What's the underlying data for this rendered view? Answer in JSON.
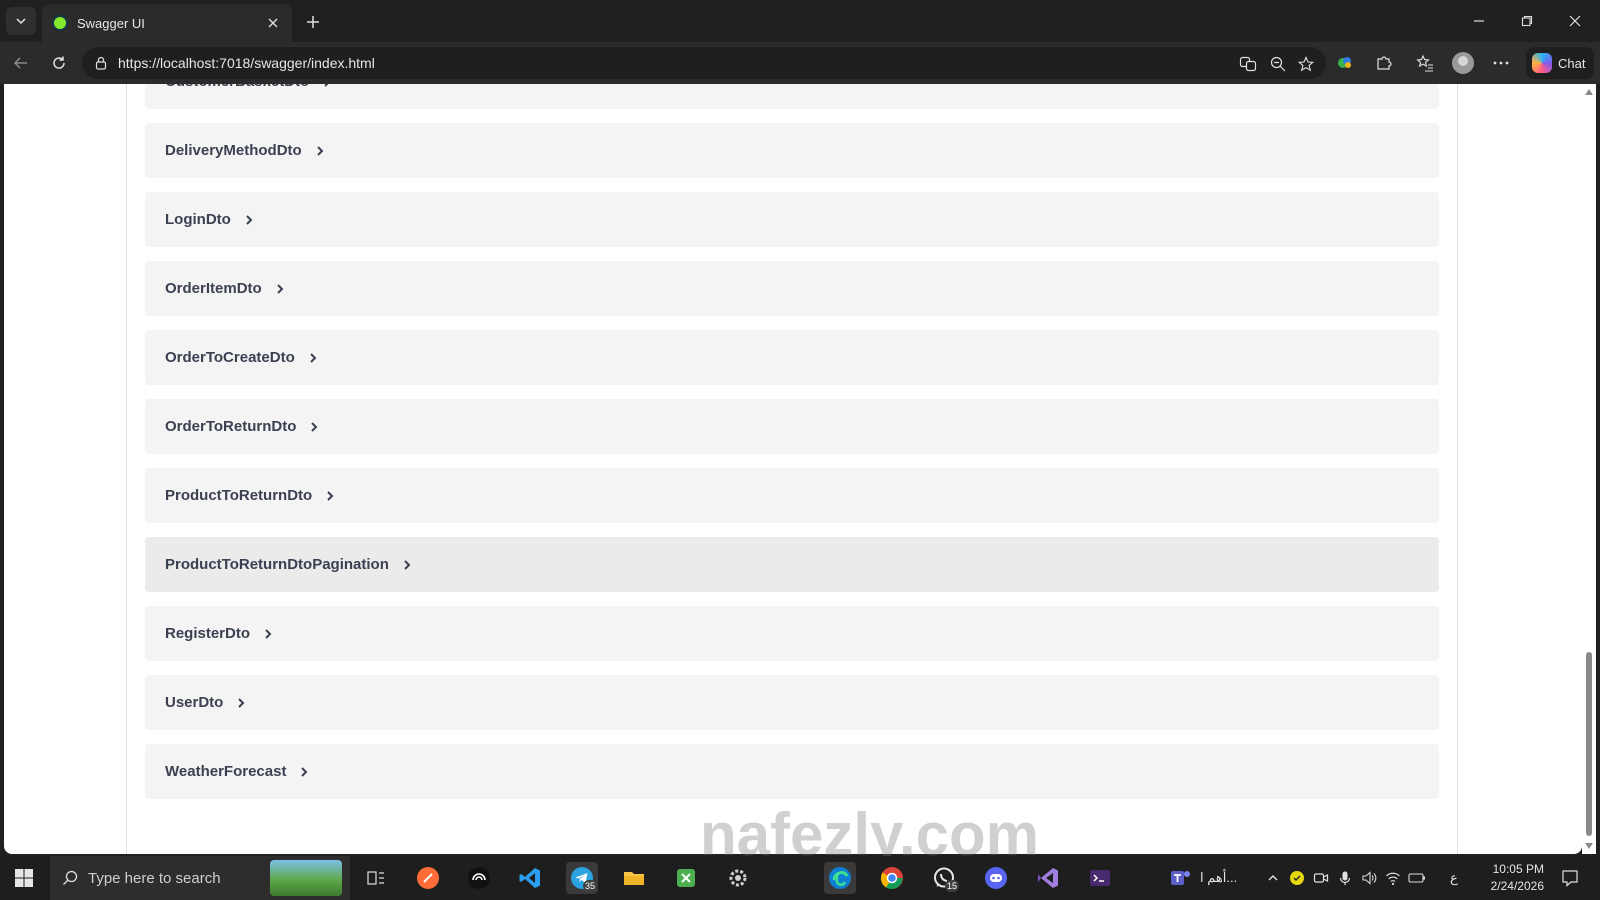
{
  "browser": {
    "tab_title": "Swagger UI",
    "url": "https://localhost:7018/swagger/index.html",
    "chat_label": "Chat"
  },
  "models": [
    "CustomerBasketDto",
    "DeliveryMethodDto",
    "LoginDto",
    "OrderItemDto",
    "OrderToCreateDto",
    "OrderToReturnDto",
    "ProductToReturnDto",
    "ProductToReturnDtoPagination",
    "RegisterDto",
    "UserDto",
    "WeatherForecast"
  ],
  "hovered_model": "ProductToReturnDtoPagination",
  "watermark": "nafezly.com",
  "taskbar": {
    "search_placeholder": "Type here to search",
    "telegram_badge": "35",
    "whatsapp_badge": "15",
    "tray_app_label": "أهم ا...",
    "input_language": "ع",
    "time": "10:05 PM",
    "date": "2/24/2026"
  },
  "colors": {
    "model_text": "#3b4151",
    "row_bg": "#f4f4f4",
    "swagger_green": "#85ea2d"
  }
}
